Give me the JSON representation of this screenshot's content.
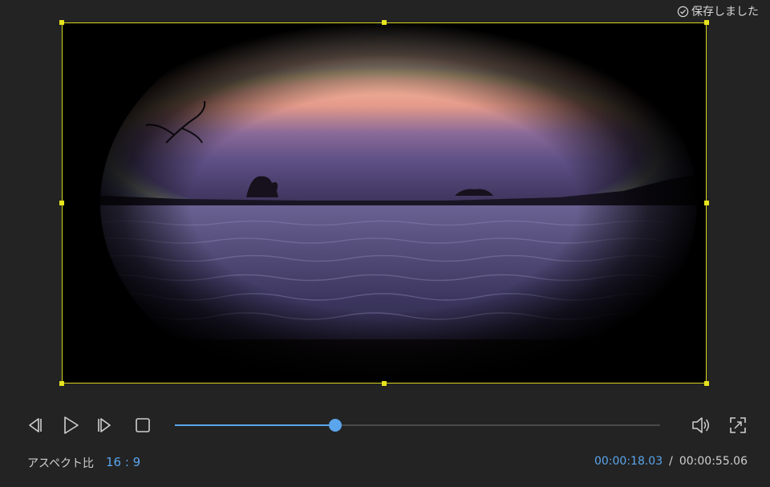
{
  "status": {
    "saved_text": "保存しました",
    "icon": "check-circle-icon"
  },
  "preview": {
    "frame_color": "#d7d41e"
  },
  "controls": {
    "buttons": [
      {
        "name": "prev-frame-button",
        "icon": "step-back-icon"
      },
      {
        "name": "play-button",
        "icon": "play-icon"
      },
      {
        "name": "next-frame-button",
        "icon": "step-forward-icon"
      },
      {
        "name": "stop-button",
        "icon": "stop-icon"
      }
    ],
    "progress_fraction": 0.33,
    "accent": "#5aa5ec",
    "right_buttons": [
      {
        "name": "volume-button",
        "icon": "speaker-icon"
      },
      {
        "name": "fullscreen-button",
        "icon": "fullscreen-icon"
      }
    ]
  },
  "aspect": {
    "label": "アスペクト比",
    "value": "16 : 9"
  },
  "time": {
    "current": "00:00:18.03",
    "separator": "/",
    "total": "00:00:55.06"
  }
}
